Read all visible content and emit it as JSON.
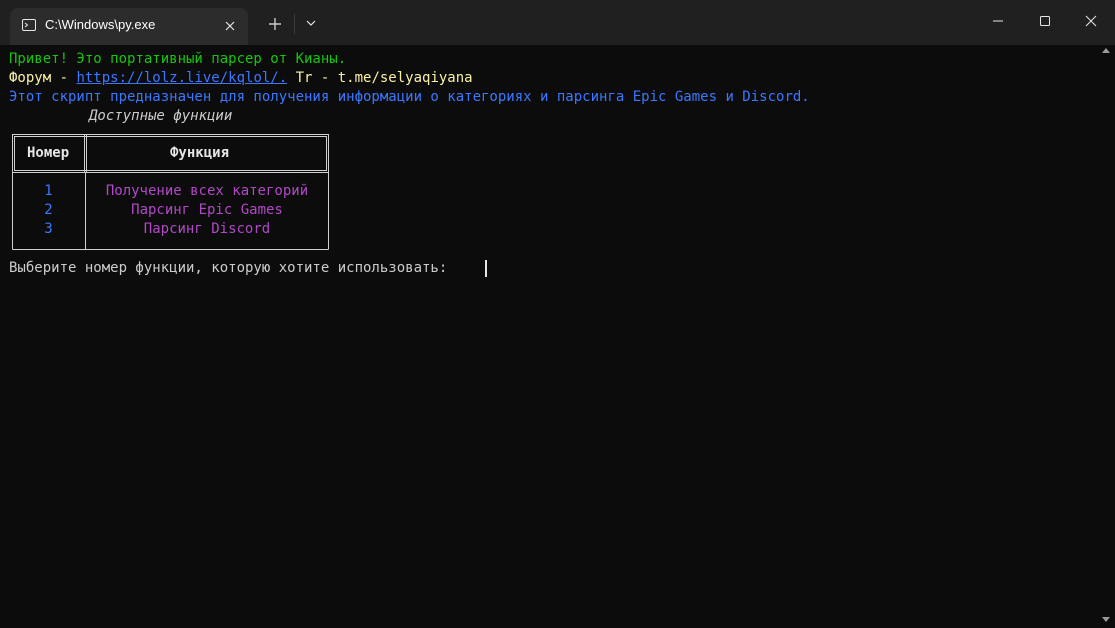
{
  "window": {
    "tab_title": "C:\\Windows\\py.exe"
  },
  "terminal": {
    "greeting": "Привет! Это портативный парсер от Кианы.",
    "forum_prefix": "Форум - ",
    "forum_link": "https://lolz.live/kqlol/.",
    "tg_text": " Tr - t.me/selyaqiyana",
    "description": "Этот скрипт предназначен для получения информации о категориях и парсинга Epic Games и Discord.",
    "table_caption": "Доступные функции",
    "table": {
      "headers": [
        "Номер",
        "Функция"
      ],
      "rows": [
        {
          "number": "1",
          "function": "Получение всех категорий"
        },
        {
          "number": "2",
          "function": "Парсинг Epic Games"
        },
        {
          "number": "3",
          "function": "Парсинг Discord"
        }
      ]
    },
    "prompt": "Выберите номер функции, которую хотите использовать: "
  },
  "colors": {
    "background": "#0c0c0c",
    "green": "#16c60c",
    "yellow": "#f9f1a5",
    "blue": "#3b78ff",
    "magenta": "#b148c6"
  },
  "icons": [
    "terminal-icon",
    "close-icon",
    "plus-icon",
    "chevron-down-icon",
    "minimize-icon",
    "maximize-icon",
    "window-close-icon",
    "scroll-up-icon",
    "scroll-down-icon"
  ]
}
